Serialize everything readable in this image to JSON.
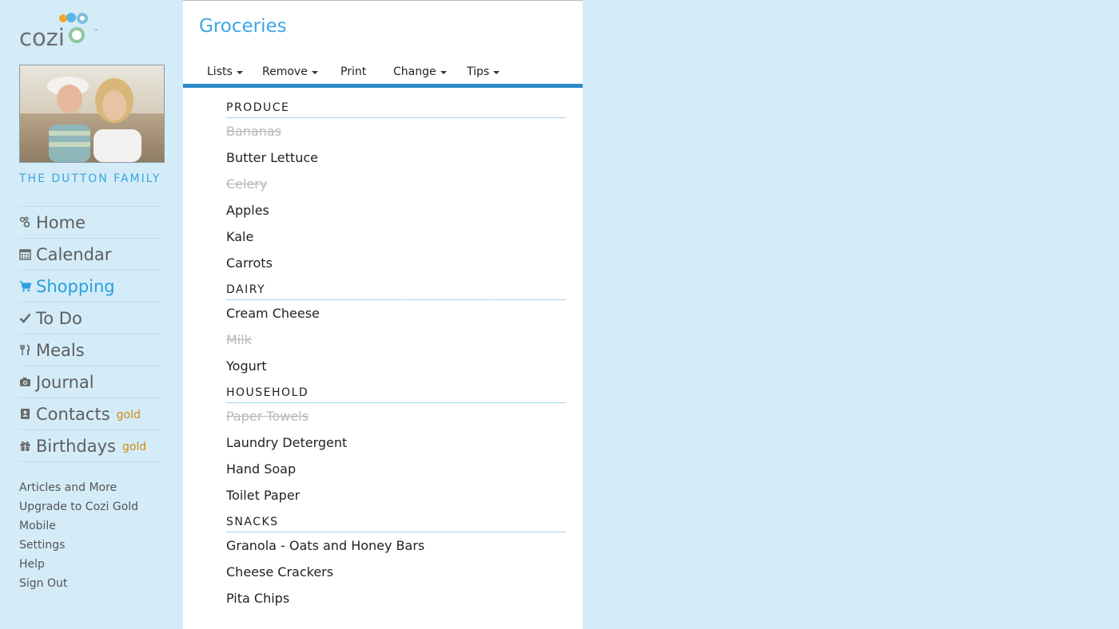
{
  "app": {
    "logo_text": "cozi",
    "logo_tm": "™",
    "family_name": "THE DUTTON FAMILY"
  },
  "colors": {
    "accent": "#3da5e4",
    "sidebar_bg": "#d3ecf8",
    "gold": "#d18b0f",
    "checked_item": "#b8b8b8"
  },
  "nav": [
    {
      "label": "Home",
      "icon": "home-icon",
      "active": false,
      "gold": ""
    },
    {
      "label": "Calendar",
      "icon": "calendar-icon",
      "active": false,
      "gold": ""
    },
    {
      "label": "Shopping",
      "icon": "shopping-cart-icon",
      "active": true,
      "gold": ""
    },
    {
      "label": "To Do",
      "icon": "checkmark-icon",
      "active": false,
      "gold": ""
    },
    {
      "label": "Meals",
      "icon": "fork-knife-icon",
      "active": false,
      "gold": ""
    },
    {
      "label": "Journal",
      "icon": "camera-icon",
      "active": false,
      "gold": ""
    },
    {
      "label": "Contacts",
      "icon": "address-book-icon",
      "active": false,
      "gold": "gold"
    },
    {
      "label": "Birthdays",
      "icon": "gift-icon",
      "active": false,
      "gold": "gold"
    }
  ],
  "links": [
    "Articles and More",
    "Upgrade to Cozi Gold",
    "Mobile",
    "Settings",
    "Help",
    "Sign Out"
  ],
  "page": {
    "title": "Groceries"
  },
  "toolbar": {
    "lists": "Lists",
    "remove": "Remove",
    "print": "Print",
    "change": "Change",
    "tips": "Tips"
  },
  "sections": [
    {
      "name": "PRODUCE",
      "items": [
        {
          "label": "Bananas",
          "checked": true
        },
        {
          "label": "Butter Lettuce",
          "checked": false
        },
        {
          "label": "Celery",
          "checked": true
        },
        {
          "label": "Apples",
          "checked": false
        },
        {
          "label": "Kale",
          "checked": false
        },
        {
          "label": "Carrots",
          "checked": false
        }
      ]
    },
    {
      "name": "DAIRY",
      "items": [
        {
          "label": "Cream Cheese",
          "checked": false
        },
        {
          "label": "Milk",
          "checked": true
        },
        {
          "label": "Yogurt",
          "checked": false
        }
      ]
    },
    {
      "name": "HOUSEHOLD",
      "items": [
        {
          "label": "Paper Towels",
          "checked": true
        },
        {
          "label": "Laundry Detergent",
          "checked": false
        },
        {
          "label": "Hand Soap",
          "checked": false
        },
        {
          "label": "Toilet Paper",
          "checked": false
        }
      ]
    },
    {
      "name": "SNACKS",
      "items": [
        {
          "label": "Granola - Oats and Honey Bars",
          "checked": false
        },
        {
          "label": "Cheese Crackers",
          "checked": false
        },
        {
          "label": "Pita Chips",
          "checked": false
        }
      ]
    }
  ]
}
